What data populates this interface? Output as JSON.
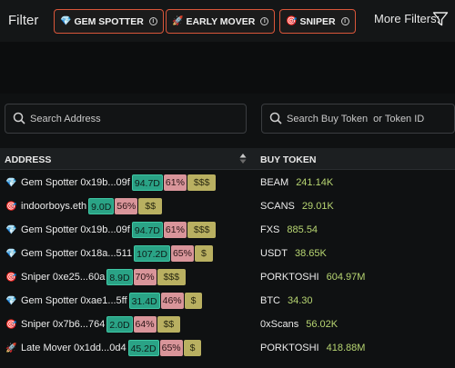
{
  "filter": {
    "label": "Filter",
    "chips": [
      {
        "emoji": "💎",
        "label": "GEM SPOTTER",
        "info": "i"
      },
      {
        "emoji": "🚀",
        "label": "EARLY MOVER",
        "info": "i"
      },
      {
        "emoji": "🎯",
        "label": "SNIPER",
        "info": "i"
      }
    ],
    "more_label": "More Filters:"
  },
  "search": {
    "address_placeholder": "Search Address",
    "token_placeholder": "Search Buy Token  or Token ID"
  },
  "table": {
    "headers": {
      "address": "ADDRESS",
      "buy_token": "BUY TOKEN"
    },
    "rows": [
      {
        "emoji": "💎",
        "address": "Gem Spotter 0x19b...09f",
        "age": "94.7D",
        "pct": "61%",
        "money": "$$$",
        "token": "BEAM",
        "amount": "241.14K"
      },
      {
        "emoji": "🎯",
        "address": "indoorboys.eth",
        "age": "9.0D",
        "pct": "56%",
        "money": "$$",
        "token": "SCANS",
        "amount": "29.01K"
      },
      {
        "emoji": "💎",
        "address": "Gem Spotter 0x19b...09f",
        "age": "94.7D",
        "pct": "61%",
        "money": "$$$",
        "token": "FXS",
        "amount": "885.54"
      },
      {
        "emoji": "💎",
        "address": "Gem Spotter 0x18a...511",
        "age": "107.2D",
        "pct": "65%",
        "money": "$",
        "token": "USDT",
        "amount": "38.65K"
      },
      {
        "emoji": "🎯",
        "address": "Sniper 0xe25...60a",
        "age": "8.9D",
        "pct": "70%",
        "money": "$$$",
        "token": "PORKTOSHI",
        "amount": "604.97M"
      },
      {
        "emoji": "💎",
        "address": "Gem Spotter 0xae1...5ff",
        "age": "31.4D",
        "pct": "46%",
        "money": "$",
        "token": "BTC",
        "amount": "34.30"
      },
      {
        "emoji": "🎯",
        "address": "Sniper 0x7b6...764",
        "age": "2.0D",
        "pct": "64%",
        "money": "$$",
        "token": "0xScans",
        "amount": "56.02K"
      },
      {
        "emoji": "🚀",
        "address": "Late Mover 0x1dd...0d4",
        "age": "45.2D",
        "pct": "65%",
        "money": "$",
        "token": "PORKTOSHI",
        "amount": "418.88M"
      }
    ]
  }
}
